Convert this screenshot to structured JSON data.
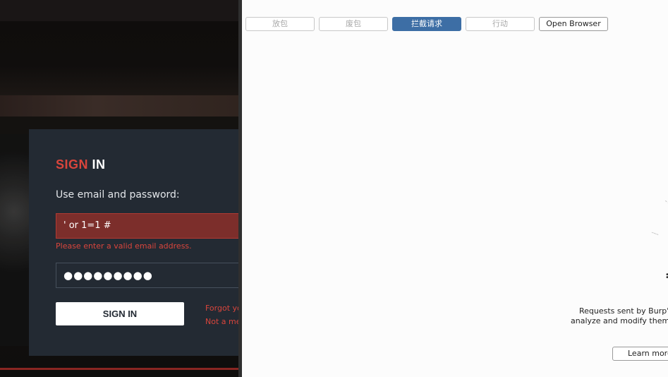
{
  "site": {
    "title_accent": "SIGN",
    "title_rest": " IN",
    "subtitle": "Use email and password:",
    "email_value": "' or 1=1 #",
    "email_error": "Please enter a valid email address.",
    "password_masked": "●●●●●●●●●",
    "signin_label": "SIGN IN",
    "forgot_link": "Forgot yo",
    "not_member_link": "Not a me",
    "colors": {
      "accent": "#d9453c",
      "card": "#232a33",
      "error_field": "#7c2e2b"
    }
  },
  "burp": {
    "toolbar": {
      "forward": "放包",
      "drop": "废包",
      "intercept": "拦截请求",
      "action": "行动",
      "open_browser": "Open Browser"
    },
    "info_line1": "Requests sent by Burp's br",
    "info_line2": "analyze and modify them bef",
    "learn_more": "Learn more",
    "colors": {
      "intercept_active": "#3d6ea5"
    }
  }
}
